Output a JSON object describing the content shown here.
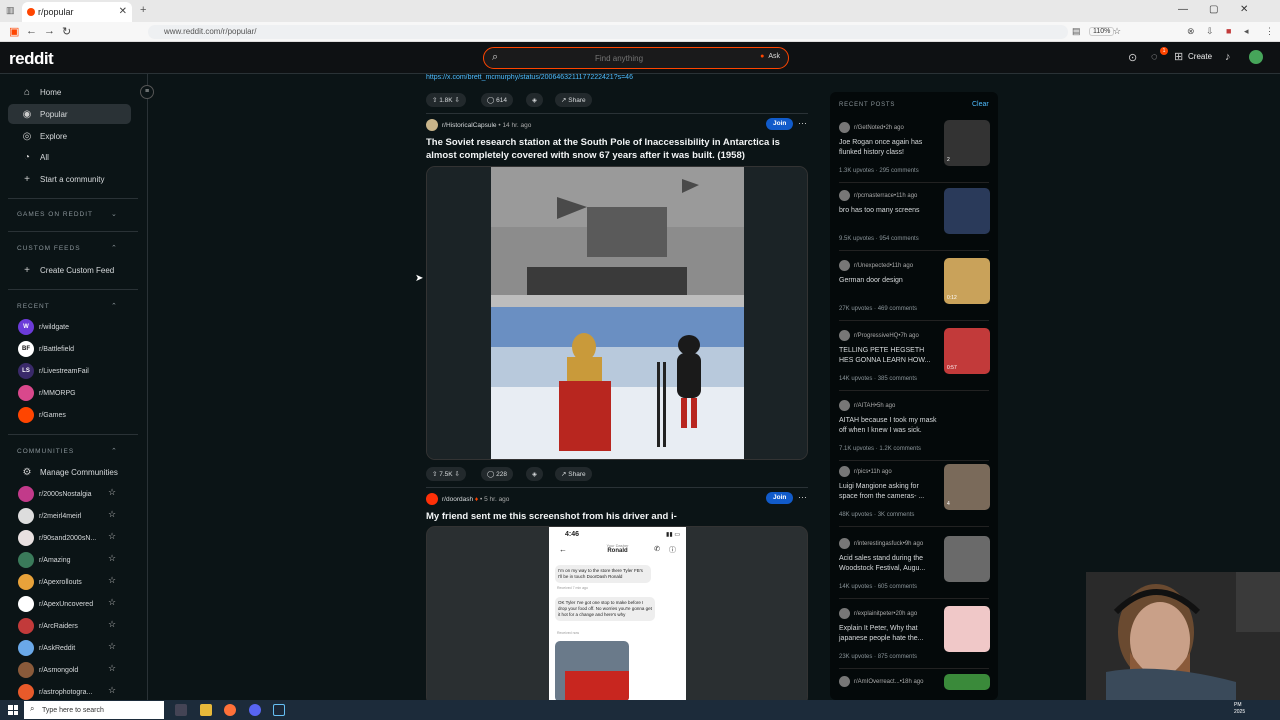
{
  "browser": {
    "tab_title": "r/popular",
    "url": "www.reddit.com/r/popular/",
    "zoom": "110%"
  },
  "header": {
    "logo": "reddit",
    "search_placeholder": "Find anything",
    "ask_label": "Ask",
    "create_label": "Create",
    "chat_badge": "1"
  },
  "sidebar": {
    "nav": [
      {
        "label": "Home",
        "icon": "home-icon"
      },
      {
        "label": "Popular",
        "icon": "popular-icon"
      },
      {
        "label": "Explore",
        "icon": "explore-icon"
      },
      {
        "label": "All",
        "icon": "all-icon"
      },
      {
        "label": "Start a community",
        "icon": "plus-icon"
      }
    ],
    "games_header": "GAMES ON REDDIT",
    "custom_feeds_header": "CUSTOM FEEDS",
    "create_custom_feed": "Create Custom Feed",
    "recent_header": "RECENT",
    "recent": [
      {
        "label": "r/wildgate",
        "color": "#6c3bd9",
        "initial": "W"
      },
      {
        "label": "r/Battlefield",
        "color": "#ffffff",
        "initial": "BF"
      },
      {
        "label": "r/LivestreamFail",
        "color": "#3a2a6a",
        "initial": "LS"
      },
      {
        "label": "r/MMORPG",
        "color": "#d9488c",
        "initial": ""
      },
      {
        "label": "r/Games",
        "color": "#ff4500",
        "initial": ""
      }
    ],
    "communities_header": "COMMUNITIES",
    "manage_communities": "Manage Communities",
    "communities": [
      {
        "label": "r/2000sNostalgia",
        "color": "#c23a8a"
      },
      {
        "label": "r/2meirl4meirl",
        "color": "#dddddd"
      },
      {
        "label": "r/90sand2000sN...",
        "color": "#e8e0e0"
      },
      {
        "label": "r/Amazing",
        "color": "#3a7a5a"
      },
      {
        "label": "r/Apexrollouts",
        "color": "#e8a23a"
      },
      {
        "label": "r/ApexUncovered",
        "color": "#ffffff"
      },
      {
        "label": "r/ArcRaiders",
        "color": "#c23a3a"
      },
      {
        "label": "r/AskReddit",
        "color": "#6aa8e8"
      },
      {
        "label": "r/Asmongold",
        "color": "#8a5a3a"
      },
      {
        "label": "r/astrophotogra...",
        "color": "#e85a2a"
      }
    ]
  },
  "feed": {
    "prev_link": "https://x.com/brett_mcmurphy/status/2006463211177222421?s=46",
    "prev_actions": {
      "upvotes": "1.8K",
      "comments": "614",
      "share": "Share"
    },
    "posts": [
      {
        "subreddit": "r/HistoricalCapsule",
        "time": "14 hr. ago",
        "join": "Join",
        "title": "The Soviet research station at the South Pole of Inaccessibility in Antarctica is almost completely covered with snow 67 years after it was built. (1958)",
        "upvotes": "7.5K",
        "comments": "228",
        "share": "Share"
      },
      {
        "subreddit": "r/doordash",
        "time": "5 hr. ago",
        "join": "Join",
        "title": "My friend sent me this screenshot from his driver and i-",
        "phone": {
          "clock": "4:46",
          "contact_role": "Your Dasher",
          "contact_name": "Ronald",
          "msg1": "I'm on my way to the store there Tyler FB's I'll be in touch DoorDash Ronald",
          "msg1_meta": "Received 7 min ago",
          "msg2": "OK Tyler I've got one stop to make before I drop your food off. No worries you're gonna get it hot for a change and here's why",
          "msg2_meta": "Received now"
        }
      }
    ]
  },
  "recent_posts": {
    "header": "RECENT POSTS",
    "clear": "Clear",
    "items": [
      {
        "sub": "r/GetNoted",
        "time": "2h ago",
        "title": "Joe Rogan once again has flunked history class!",
        "upvotes": "1.3K upvotes",
        "comments": "295 comments",
        "thumb": "#333333",
        "badge": "2"
      },
      {
        "sub": "r/pcmasterrace",
        "time": "11h ago",
        "title": "bro has too many screens",
        "upvotes": "9.5K upvotes",
        "comments": "954 comments",
        "thumb": "#2a3a5a",
        "badge": ""
      },
      {
        "sub": "r/Unexpected",
        "time": "11h ago",
        "title": "German door design",
        "upvotes": "27K upvotes",
        "comments": "469 comments",
        "thumb": "#c9a25a",
        "badge": "0:12"
      },
      {
        "sub": "r/ProgressiveHQ",
        "time": "7h ago",
        "title": "TELLING PETE HEGSETH HES GONNA LEARN HOW...",
        "upvotes": "14K upvotes",
        "comments": "385 comments",
        "thumb": "#c23a3a",
        "badge": "0:57"
      },
      {
        "sub": "r/AITAH",
        "time": "5h ago",
        "title": "AITAH because I took my mask off when I knew I was sick.",
        "upvotes": "7.1K upvotes",
        "comments": "1.2K comments",
        "thumb": "",
        "badge": ""
      },
      {
        "sub": "r/pics",
        "time": "11h ago",
        "title": "Luigi Mangione asking for space from the cameras- ...",
        "upvotes": "48K upvotes",
        "comments": "3K comments",
        "thumb": "#7a6a5a",
        "badge": "4"
      },
      {
        "sub": "r/interestingasfuck",
        "time": "9h ago",
        "title": "Acid sales stand during the Woodstock Festival, Augu...",
        "upvotes": "14K upvotes",
        "comments": "605 comments",
        "thumb": "#6a6a6a",
        "badge": ""
      },
      {
        "sub": "r/explainitpeter",
        "time": "20h ago",
        "title": "Explain It Peter, Why that japanese people hate the...",
        "upvotes": "23K upvotes",
        "comments": "875 comments",
        "thumb": "#f0c8c8",
        "badge": ""
      },
      {
        "sub": "r/AmIOverreact...",
        "time": "18h ago",
        "title": "",
        "upvotes": "",
        "comments": "",
        "thumb": "#3a8a3a",
        "badge": ""
      }
    ]
  },
  "taskbar": {
    "search_placeholder": "Type here to search",
    "clock_time": "PM",
    "clock_date": "2025"
  }
}
